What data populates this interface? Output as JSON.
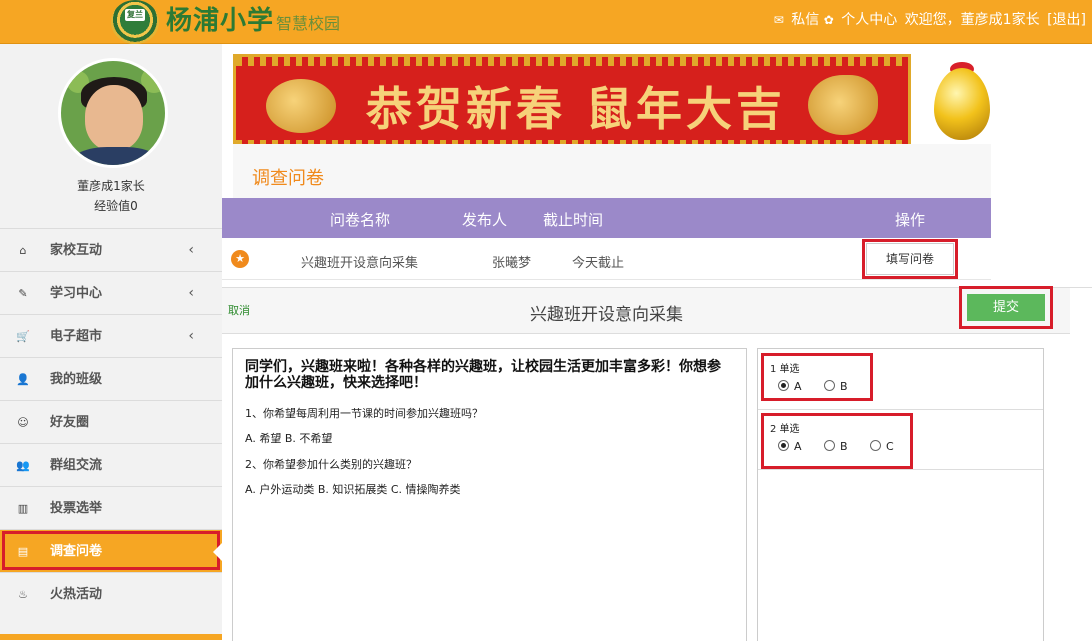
{
  "header": {
    "badge_text": "复兰",
    "school_name": "杨浦小学",
    "school_sub": "智慧校园",
    "links": {
      "messages": "私信",
      "profile": "个人中心",
      "welcome": "欢迎您，董彦成1家长",
      "logout": "[退出]"
    },
    "icons": {
      "messages": "envelope-icon",
      "profile": "gear-icon"
    }
  },
  "sidebar": {
    "user_name": "董彦成1家长",
    "experience": "经验值0",
    "items": [
      {
        "label": "家校互动",
        "icon": "home-icon",
        "glyph": "⌂",
        "arrow": true
      },
      {
        "label": "学习中心",
        "icon": "edit-icon",
        "glyph": "✎",
        "arrow": true
      },
      {
        "label": "电子超市",
        "icon": "cart-icon",
        "glyph": "🛒",
        "arrow": true
      },
      {
        "label": "我的班级",
        "icon": "user-icon",
        "glyph": "👤",
        "arrow": false
      },
      {
        "label": "好友圈",
        "icon": "smile-icon",
        "glyph": "☺",
        "arrow": false
      },
      {
        "label": "群组交流",
        "icon": "users-icon",
        "glyph": "👥",
        "arrow": false
      },
      {
        "label": "投票选举",
        "icon": "bar-chart-icon",
        "glyph": "▥",
        "arrow": false
      },
      {
        "label": "调查问卷",
        "icon": "file-icon",
        "glyph": "▤",
        "arrow": false,
        "active": true
      },
      {
        "label": "火热活动",
        "icon": "fire-icon",
        "glyph": "♨",
        "arrow": false
      }
    ]
  },
  "banner": {
    "text": "恭贺新春 鼠年大吉"
  },
  "survey": {
    "section_title": "调查问卷",
    "columns": [
      "问卷名称",
      "发布人",
      "截止时间",
      "操作"
    ],
    "rows": [
      {
        "name": "兴趣班开设意向采集",
        "publisher": "张曦梦",
        "deadline": "今天截止",
        "action": "填写问卷"
      }
    ]
  },
  "modal": {
    "cancel": "取消",
    "title": "兴趣班开设意向采集",
    "submit": "提交",
    "intro": "同学们，兴趣班来啦！各种各样的兴趣班，让校园生活更加丰富多彩！你想参加什么兴趣班，快来选择吧！",
    "questions": [
      {
        "text": "1、你希望每周利用一节课的时间参加兴趣班吗？",
        "options_text": "A. 希望 B. 不希望"
      },
      {
        "text": "2、你希望参加什么类别的兴趣班？",
        "options_text": "A. 户外运动类 B. 知识拓展类 C. 情操陶养类"
      }
    ],
    "answers": [
      {
        "label": "1 单选",
        "options": [
          "A",
          "B"
        ],
        "selected": "A"
      },
      {
        "label": "2 单选",
        "options": [
          "A",
          "B",
          "C"
        ],
        "selected": "A"
      }
    ]
  },
  "colors": {
    "header_orange": "#f6a623",
    "table_header_purple": "#9b89c9",
    "submit_green": "#5cb85c",
    "highlight_red": "#d71d2a",
    "title_orange": "#f08a1c"
  }
}
